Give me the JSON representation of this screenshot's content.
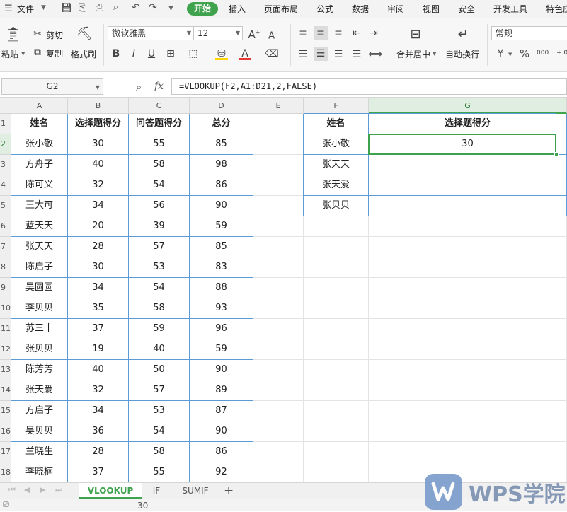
{
  "menubar": {
    "file_label": "文件",
    "tabs": [
      "开始",
      "插入",
      "页面布局",
      "公式",
      "数据",
      "审阅",
      "视图",
      "安全",
      "开发工具",
      "特色应"
    ]
  },
  "ribbon": {
    "paste_label": "粘贴",
    "cut_label": "剪切",
    "copy_label": "复制",
    "format_painter_label": "格式刷",
    "font_name": "微软雅黑",
    "font_size": "12",
    "merge_center_label": "合并居中",
    "wrap_text_label": "自动换行",
    "number_format": "常规"
  },
  "formula_bar": {
    "name_box": "G2",
    "fx_label": "fx",
    "formula": "=VLOOKUP(F2,A1:D21,2,FALSE)"
  },
  "columns": [
    "A",
    "B",
    "C",
    "D",
    "E",
    "F",
    "G"
  ],
  "table": {
    "headers": [
      "姓名",
      "选择题得分",
      "问答题得分",
      "总分"
    ],
    "rows": [
      [
        "张小敬",
        "30",
        "55",
        "85"
      ],
      [
        "方舟子",
        "40",
        "58",
        "98"
      ],
      [
        "陈可义",
        "32",
        "54",
        "86"
      ],
      [
        "王大可",
        "34",
        "56",
        "90"
      ],
      [
        "蓝天天",
        "20",
        "39",
        "59"
      ],
      [
        "张天天",
        "28",
        "57",
        "85"
      ],
      [
        "陈启子",
        "30",
        "53",
        "83"
      ],
      [
        "吴圆圆",
        "34",
        "54",
        "88"
      ],
      [
        "李贝贝",
        "35",
        "58",
        "93"
      ],
      [
        "苏三十",
        "37",
        "59",
        "96"
      ],
      [
        "张贝贝",
        "19",
        "40",
        "59"
      ],
      [
        "陈芳芳",
        "40",
        "50",
        "90"
      ],
      [
        "张天爱",
        "32",
        "57",
        "89"
      ],
      [
        "方启子",
        "34",
        "53",
        "87"
      ],
      [
        "吴贝贝",
        "36",
        "54",
        "90"
      ],
      [
        "兰晓生",
        "28",
        "58",
        "86"
      ],
      [
        "李晓楠",
        "37",
        "55",
        "92"
      ]
    ]
  },
  "lookup": {
    "headers": [
      "姓名",
      "选择题得分"
    ],
    "rows": [
      [
        "张小敬",
        "30"
      ],
      [
        "张天天",
        ""
      ],
      [
        "张天爱",
        ""
      ],
      [
        "张贝贝",
        ""
      ]
    ]
  },
  "sheets": [
    "VLOOKUP",
    "IF",
    "SUMIF"
  ],
  "add_sheet": "+",
  "status": {
    "value": "30"
  },
  "watermark": "WPS学院",
  "colors": {
    "accent": "#3fa34d",
    "table_border": "#5b9bd5"
  }
}
